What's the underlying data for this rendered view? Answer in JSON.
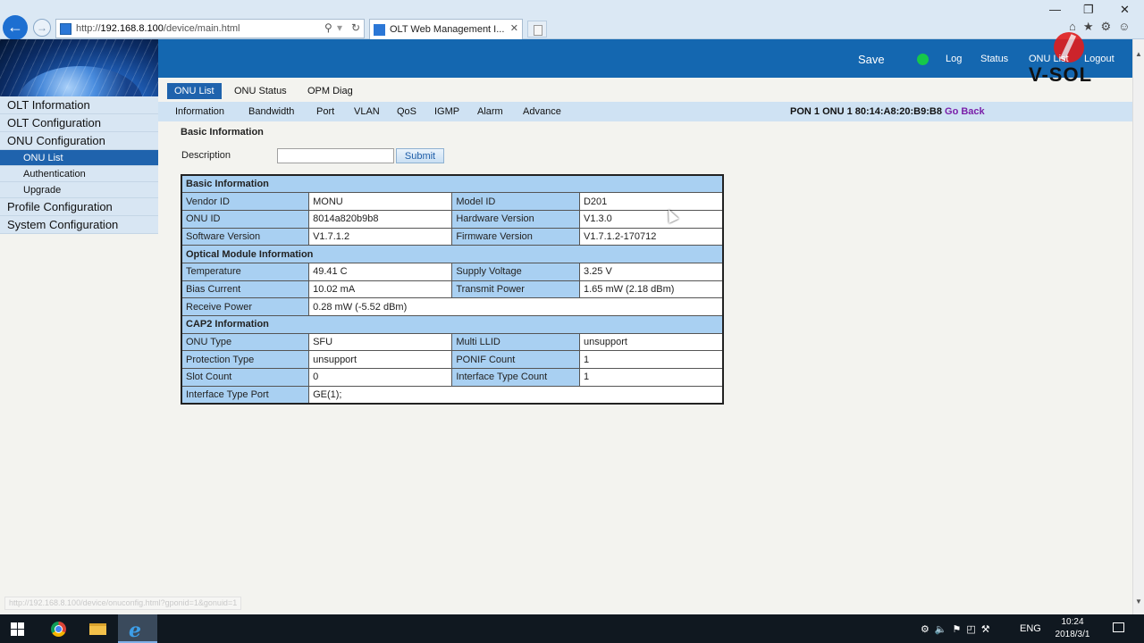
{
  "browser": {
    "url_prefix": "http://",
    "url_host": "192.168.8.100",
    "url_path": "/device/main.html",
    "tab_title": "OLT Web Management I...",
    "search_glyph": "⚲",
    "refresh_glyph": "↻",
    "tab_close": "✕",
    "min_glyph": "—",
    "restore_glyph": "❐",
    "close_glyph": "✕",
    "toolbar_icons": "⌂★⚙☺"
  },
  "header": {
    "save": "Save",
    "log": "Log",
    "status": "Status",
    "onu_list": "ONU List",
    "logout": "Logout",
    "logo": "V-SOL"
  },
  "sidebar": {
    "items": [
      {
        "label": "OLT Information"
      },
      {
        "label": "OLT Configuration"
      },
      {
        "label": "ONU Configuration"
      },
      {
        "label": "ONU List"
      },
      {
        "label": "Authentication"
      },
      {
        "label": "Upgrade"
      },
      {
        "label": "Profile Configuration"
      },
      {
        "label": "System Configuration"
      }
    ]
  },
  "tabs_primary": [
    "ONU List",
    "ONU Status",
    "OPM Diag"
  ],
  "tabs_secondary": [
    "Information",
    "Bandwidth",
    "Port",
    "VLAN",
    "QoS",
    "IGMP",
    "Alarm",
    "Advance"
  ],
  "pon_info": "PON 1 ONU 1 80:14:A8:20:B9:B8",
  "go_back": "Go Back",
  "form": {
    "section_title": "Basic Information",
    "description_label": "Description",
    "description_value": "",
    "submit": "Submit"
  },
  "info": {
    "basic_header": "Basic Information",
    "vendor_id_label": "Vendor ID",
    "vendor_id": "MONU",
    "model_id_label": "Model ID",
    "model_id": "D201",
    "onu_id_label": "ONU ID",
    "onu_id": "8014a820b9b8",
    "hw_label": "Hardware Version",
    "hw": "V1.3.0",
    "sw_label": "Software Version",
    "sw": "V1.7.1.2",
    "fw_label": "Firmware Version",
    "fw": "V1.7.1.2-170712",
    "optical_header": "Optical Module Information",
    "temp_label": "Temperature",
    "temp": "49.41 C",
    "volt_label": "Supply Voltage",
    "volt": "3.25 V",
    "bias_label": "Bias Current",
    "bias": "10.02 mA",
    "tx_label": "Transmit Power",
    "tx": "1.65 mW (2.18 dBm)",
    "rx_label": "Receive Power",
    "rx": "0.28 mW (-5.52 dBm)",
    "cap2_header": "CAP2 Information",
    "onu_type_label": "ONU Type",
    "onu_type": "SFU",
    "multi_llid_label": "Multi LLID",
    "multi_llid": "unsupport",
    "protection_label": "Protection Type",
    "protection": "unsupport",
    "ponif_label": "PONIF Count",
    "ponif": "1",
    "slot_label": "Slot Count",
    "slot": "0",
    "iftype_count_label": "Interface Type Count",
    "iftype_count": "1",
    "iftype_port_label": "Interface Type Port",
    "iftype_port": "GE(1);"
  },
  "status_url": "http://192.168.8.100/device/onuconfig.html?gponid=1&gonuid=1",
  "taskbar": {
    "tray_icons": "⚙🔈⚑◰⚒",
    "lang": "ENG",
    "time": "10:24",
    "date": "2018/3/1"
  },
  "colors": {
    "header_blue": "#1467b0",
    "active_tab": "#1f63ad",
    "table_label": "#a9d0f2",
    "status_led": "#16c84a"
  }
}
